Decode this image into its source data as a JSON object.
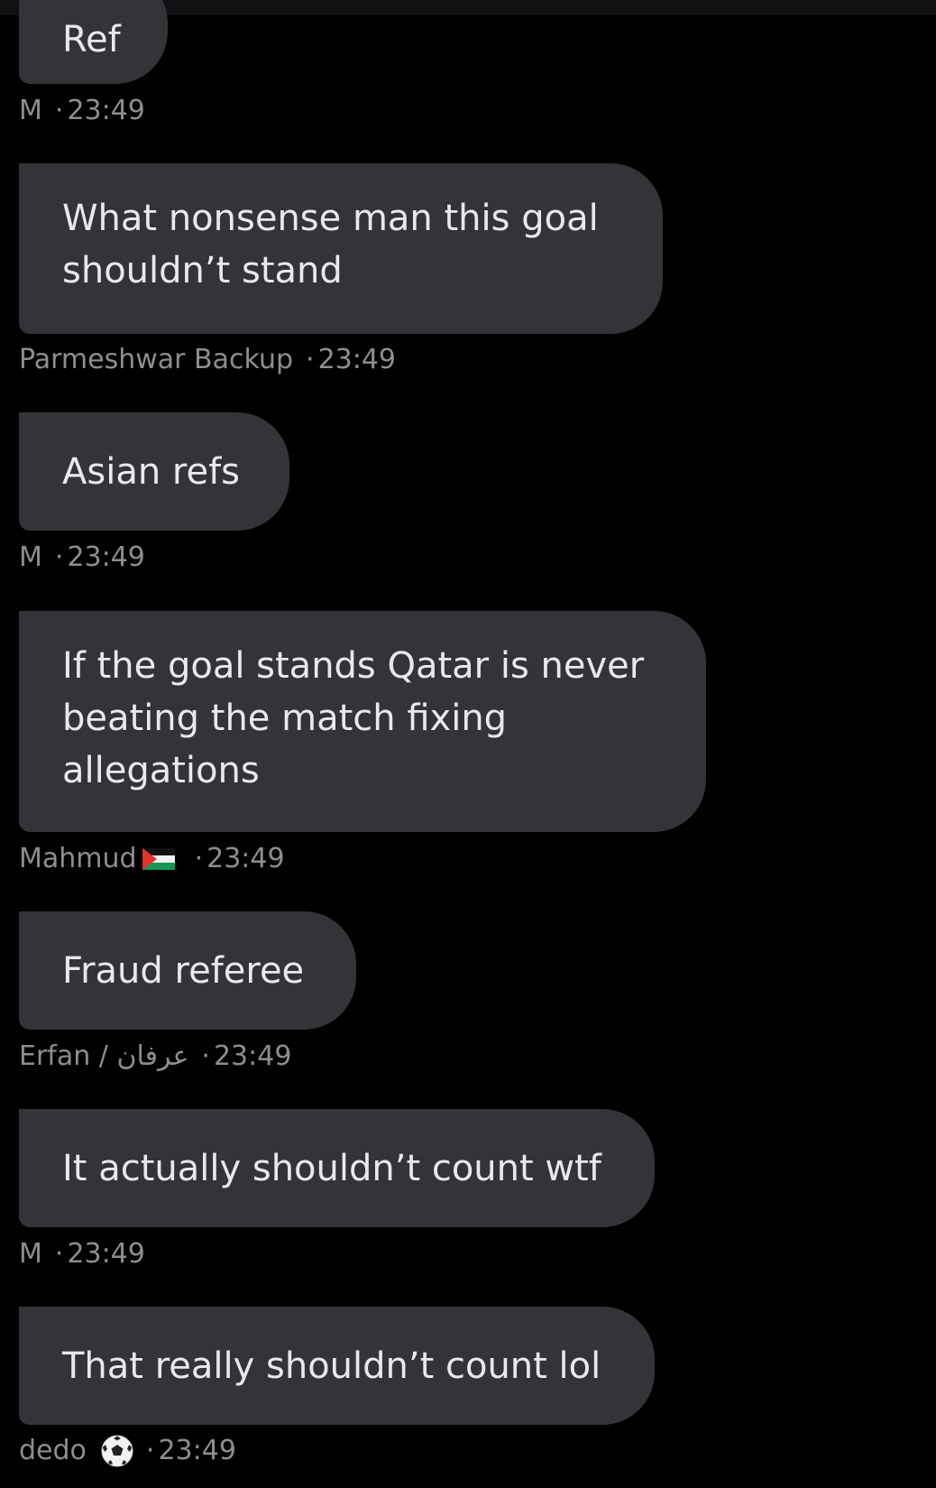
{
  "messages": [
    {
      "text_lines": [
        "Ref"
      ],
      "sender": "M",
      "time": "23:49"
    },
    {
      "text_lines": [
        "What nonsense man this goal",
        "shouldn’t stand"
      ],
      "sender": "Parmeshwar Backup",
      "time": "23:49"
    },
    {
      "text_lines": [
        "Asian refs"
      ],
      "sender": "M",
      "time": "23:49"
    },
    {
      "text_lines": [
        "If the goal stands Qatar is never",
        "beating the match fixing",
        "allegations"
      ],
      "sender": "Mahmud",
      "sender_icon": "palestine-flag-icon",
      "time": "23:49"
    },
    {
      "text_lines": [
        "Fraud referee"
      ],
      "sender": "Erfan / عرفان",
      "time": "23:49"
    },
    {
      "text_lines": [
        "It actually shouldn’t count wtf"
      ],
      "sender": "M",
      "time": "23:49"
    },
    {
      "text_lines": [
        "That really shouldn’t count lol"
      ],
      "sender": "dedo",
      "sender_icon": "soccer-ball-icon",
      "time": "23:49"
    }
  ],
  "separator": "·",
  "colors": {
    "background": "#000000",
    "bubble": "#343438",
    "bubble_text": "#e9e9eb",
    "meta_text": "#8d8d92"
  }
}
